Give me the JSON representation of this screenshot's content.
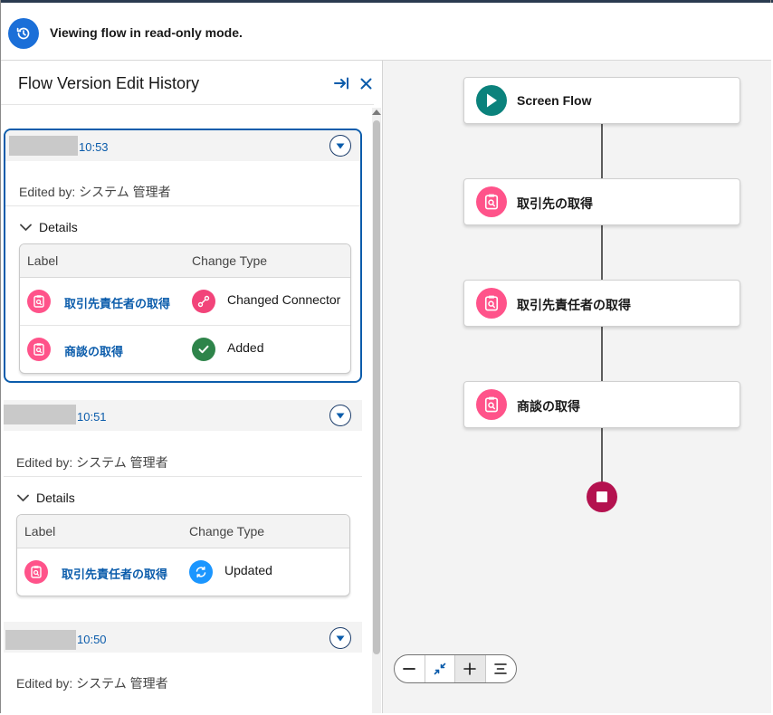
{
  "banner": {
    "text": "Viewing flow in read-only mode.",
    "icon": "history-icon"
  },
  "panel": {
    "title": "Flow Version Edit History",
    "collapse_icon": "expand-right-icon",
    "close_icon": "close-icon"
  },
  "history": [
    {
      "time": "10:53",
      "edited_by": "Edited by: システム 管理者",
      "details_label": "Details",
      "col_label": "Label",
      "col_change": "Change Type",
      "rows": [
        {
          "label": "取引先責任者の取得",
          "change": "Changed Connector",
          "change_icon": "connector-icon",
          "change_color": "#f2447a"
        },
        {
          "label": "商談の取得",
          "change": "Added",
          "change_icon": "check-icon",
          "change_color": "#2e844a"
        }
      ]
    },
    {
      "time": "10:51",
      "edited_by": "Edited by: システム 管理者",
      "details_label": "Details",
      "col_label": "Label",
      "col_change": "Change Type",
      "rows": [
        {
          "label": "取引先責任者の取得",
          "change": "Updated",
          "change_icon": "sync-icon",
          "change_color": "#1b96ff"
        }
      ]
    },
    {
      "time": "10:50",
      "edited_by": "Edited by: システム 管理者"
    }
  ],
  "canvas": {
    "nodes": [
      {
        "label": "Screen Flow",
        "icon": "play-icon",
        "color": "#0b827c"
      },
      {
        "label": "取引先の取得",
        "icon": "get-records-icon",
        "color": "#ff538a"
      },
      {
        "label": "取引先責任者の取得",
        "icon": "get-records-icon",
        "color": "#ff538a"
      },
      {
        "label": "商談の取得",
        "icon": "get-records-icon",
        "color": "#ff538a"
      }
    ],
    "end_icon": "stop-icon",
    "zoom_controls": [
      "zoom-out-icon",
      "fit-icon",
      "zoom-in-icon",
      "auto-layout-icon"
    ]
  },
  "colors": {
    "accent": "#0b5cab",
    "element_pink": "#ff538a",
    "banner_blue": "#1b6fd8"
  }
}
